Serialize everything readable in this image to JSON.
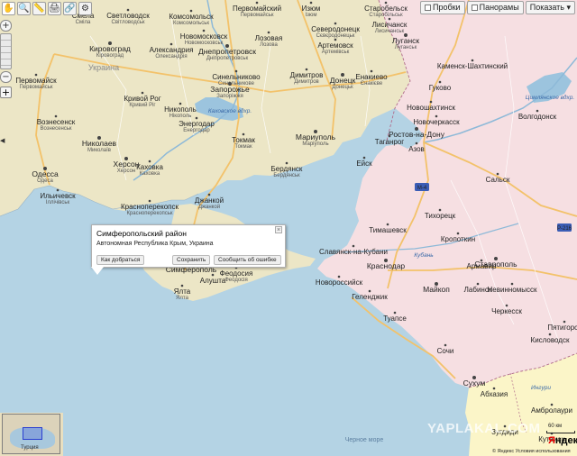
{
  "toolbar": {
    "tools": [
      {
        "name": "hand-tool",
        "glyph": "✋"
      },
      {
        "name": "magnifier-tool",
        "glyph": "🔍"
      },
      {
        "name": "ruler-tool",
        "glyph": "📏"
      },
      {
        "name": "print-tool",
        "glyph": "🖨"
      },
      {
        "name": "link-tool",
        "glyph": "🔗"
      },
      {
        "name": "settings-tool",
        "glyph": "⚙"
      }
    ]
  },
  "zoom": {
    "plus": "+",
    "minus": "−",
    "reset": "+"
  },
  "controls": {
    "traffic": "Пробки",
    "panoramas": "Панорамы",
    "show": "Показать ▾"
  },
  "popup": {
    "title": "Симферопольский район",
    "subtitle": "Автономная Республика Крым, Украина",
    "close": "×",
    "route": "Как добраться",
    "save": "Сохранить",
    "report": "Сообщить об ошибке"
  },
  "minimap": {
    "label": "Турция"
  },
  "watermark": "YAPLAKAL.COM",
  "scale": "60 км",
  "logo": {
    "y": "Я",
    "rest": "ндекс"
  },
  "copyright": "© Яндекс  Условия использования",
  "map": {
    "countries": [
      "Украина"
    ],
    "water": [
      "Каховское вдхр.",
      "Цимлянское вдхр.",
      "Ингури",
      "Кубань"
    ],
    "sea": [
      "Черное море"
    ],
    "cities": [
      {
        "name": "Смела",
        "sub": "Сміла"
      },
      {
        "name": "Светловодск",
        "sub": "Світловодськ"
      },
      {
        "name": "Комсомольск",
        "sub": "Комсомольськ"
      },
      {
        "name": "Первомайский",
        "sub": "Первомайськ"
      },
      {
        "name": "Изюм",
        "sub": "Ізюм"
      },
      {
        "name": "Старобельск",
        "sub": "Старобільськ"
      },
      {
        "name": "Северодонецк",
        "sub": "Сєвєродонецьк"
      },
      {
        "name": "Лисичанск",
        "sub": "Лисичанськ"
      },
      {
        "name": "Кировоград",
        "sub": "Кіровоград"
      },
      {
        "name": "Александрия",
        "sub": "Олександрія"
      },
      {
        "name": "Днепропетровск",
        "sub": "Дніпропетровськ"
      },
      {
        "name": "Лозовая",
        "sub": "Лозова"
      },
      {
        "name": "Артемовск",
        "sub": "Артемівськ"
      },
      {
        "name": "Луганск",
        "sub": "Луганськ"
      },
      {
        "name": "Первомайск",
        "sub": "Первомайськ"
      },
      {
        "name": "Новомосковск",
        "sub": "Новомосковськ"
      },
      {
        "name": "Запорожье",
        "sub": "Запоріжжя"
      },
      {
        "name": "Синельниково",
        "sub": "Синельникове"
      },
      {
        "name": "Димитров",
        "sub": "Димитров"
      },
      {
        "name": "Донецк",
        "sub": "Донецьк"
      },
      {
        "name": "Енакиево",
        "sub": "Єнакієве"
      },
      {
        "name": "Кривой Рог",
        "sub": "Кривий Ріг"
      },
      {
        "name": "Никополь",
        "sub": "Нікополь"
      },
      {
        "name": "Энергодар",
        "sub": "Енергодар"
      },
      {
        "name": "Вознесенск",
        "sub": "Вознесенськ"
      },
      {
        "name": "Николаев",
        "sub": "Миколаїв"
      },
      {
        "name": "Токмак",
        "sub": "Токмак"
      },
      {
        "name": "Мариуполь",
        "sub": "Маріуполь"
      },
      {
        "name": "Одесса",
        "sub": "Одеса"
      },
      {
        "name": "Херсон",
        "sub": "Херсон"
      },
      {
        "name": "Каховка",
        "sub": "Каховка"
      },
      {
        "name": "Бердянск",
        "sub": "Бердянськ"
      },
      {
        "name": "Ильичевск",
        "sub": "Іллічівськ"
      },
      {
        "name": "Красноперекопск",
        "sub": "Красноперекопськ"
      },
      {
        "name": "Джанкой",
        "sub": "Джанкой"
      },
      {
        "name": "Симферополь",
        "sub": ""
      },
      {
        "name": "Ялта",
        "sub": "Ялта"
      },
      {
        "name": "Алушта",
        "sub": ""
      },
      {
        "name": "Феодосия",
        "sub": "Феодосія"
      },
      {
        "name": "Ростов-на-Дону",
        "sub": ""
      },
      {
        "name": "Таганрог",
        "sub": ""
      },
      {
        "name": "Азов",
        "sub": ""
      },
      {
        "name": "Ейск",
        "sub": ""
      },
      {
        "name": "Гуково",
        "sub": ""
      },
      {
        "name": "Новошахтинск",
        "sub": ""
      },
      {
        "name": "Новочеркасск",
        "sub": ""
      },
      {
        "name": "Каменск-Шахтинский",
        "sub": ""
      },
      {
        "name": "Волгодонск",
        "sub": ""
      },
      {
        "name": "Сальск",
        "sub": ""
      },
      {
        "name": "Тихорецк",
        "sub": ""
      },
      {
        "name": "Тимашевск",
        "sub": ""
      },
      {
        "name": "Кропоткин",
        "sub": ""
      },
      {
        "name": "Славянск-на-Кубани",
        "sub": ""
      },
      {
        "name": "Краснодар",
        "sub": ""
      },
      {
        "name": "Армавир",
        "sub": ""
      },
      {
        "name": "Ставрополь",
        "sub": ""
      },
      {
        "name": "Новороссийск",
        "sub": ""
      },
      {
        "name": "Геленджик",
        "sub": ""
      },
      {
        "name": "Майкоп",
        "sub": ""
      },
      {
        "name": "Лабинск",
        "sub": ""
      },
      {
        "name": "Невинномысск",
        "sub": ""
      },
      {
        "name": "Черкесск",
        "sub": ""
      },
      {
        "name": "Туапсе",
        "sub": ""
      },
      {
        "name": "Сочи",
        "sub": ""
      },
      {
        "name": "Кисловодск",
        "sub": ""
      },
      {
        "name": "Пятигорск",
        "sub": ""
      },
      {
        "name": "Сухум",
        "sub": ""
      },
      {
        "name": "Абхазия",
        "sub": ""
      },
      {
        "name": "Амбролаури",
        "sub": ""
      },
      {
        "name": "Зугдиди",
        "sub": ""
      },
      {
        "name": "Кутаиси",
        "sub": ""
      }
    ],
    "roads": [
      "М-4",
      "Р-216"
    ]
  }
}
